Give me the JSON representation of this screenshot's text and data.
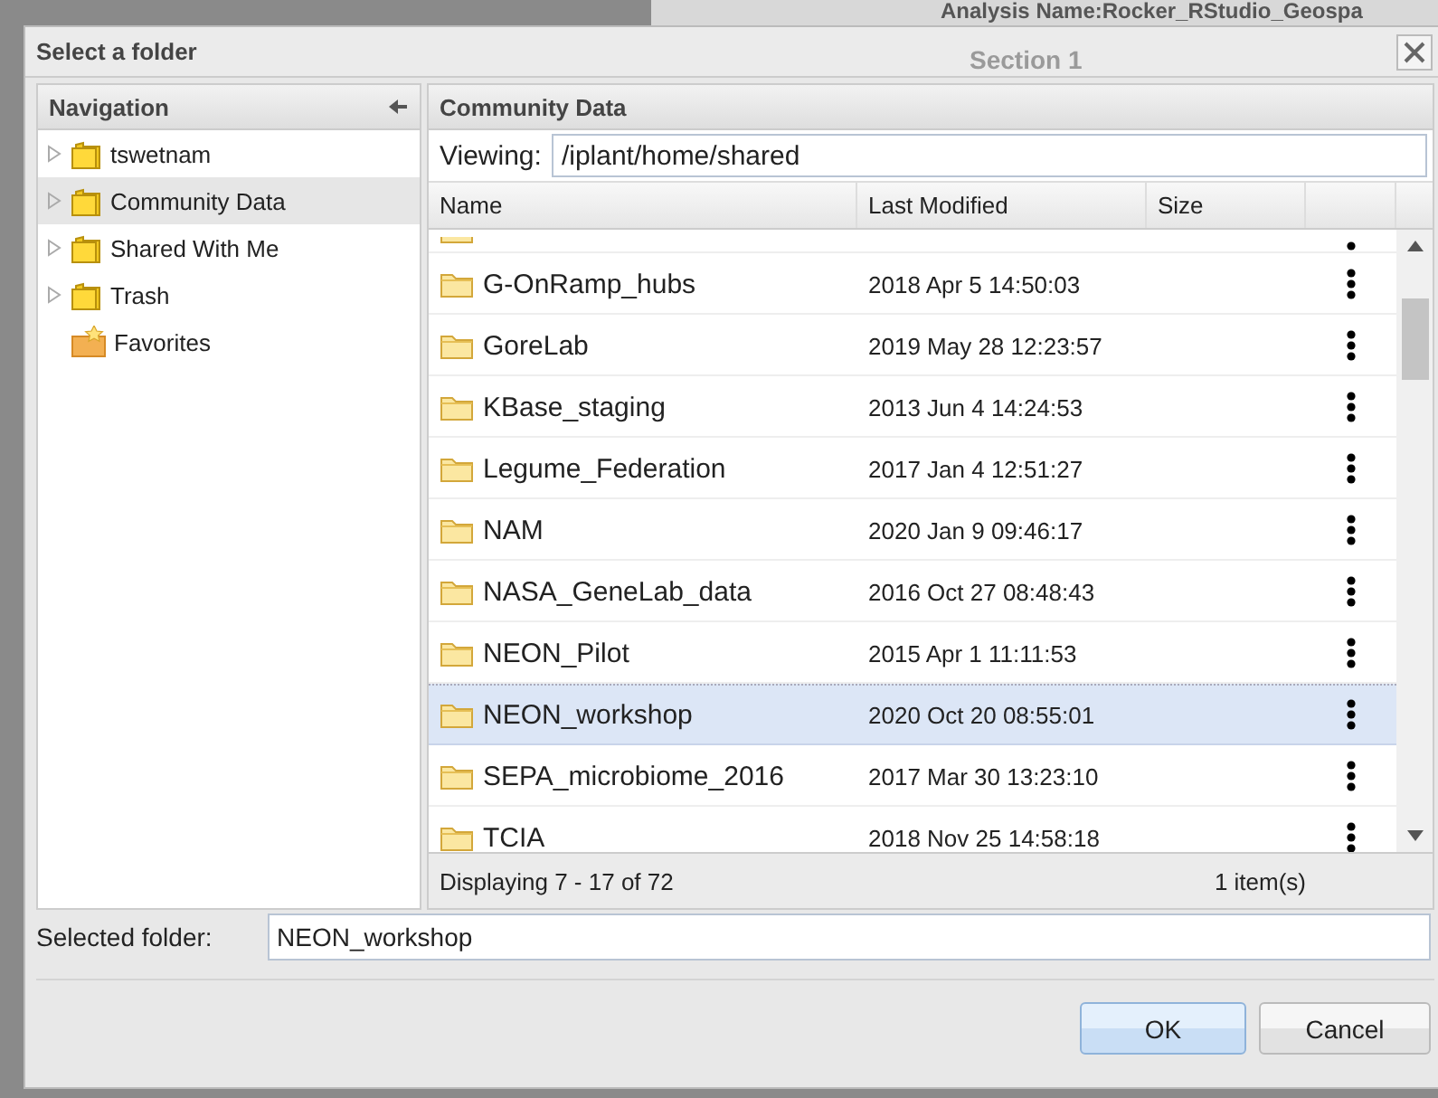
{
  "background": {
    "analysis_name": "Analysis Name:Rocker_RStudio_Geospa",
    "section": "Section 1"
  },
  "window": {
    "title": "Select a folder"
  },
  "navigation": {
    "title": "Navigation",
    "items": [
      {
        "label": "tswetnam",
        "kind": "folder",
        "selected": false
      },
      {
        "label": "Community Data",
        "kind": "folder",
        "selected": true
      },
      {
        "label": "Shared With Me",
        "kind": "folder",
        "selected": false
      },
      {
        "label": "Trash",
        "kind": "folder",
        "selected": false
      },
      {
        "label": "Favorites",
        "kind": "favorites",
        "selected": false
      }
    ]
  },
  "content": {
    "title": "Community Data",
    "viewing_label": "Viewing:",
    "path": "/iplant/home/shared",
    "columns": [
      "Name",
      "Last Modified",
      "Size"
    ],
    "rows": [
      {
        "name": "G-OnRamp_hubs",
        "modified": "2018 Apr 5 14:50:03",
        "selected": false
      },
      {
        "name": "GoreLab",
        "modified": "2019 May 28 12:23:57",
        "selected": false
      },
      {
        "name": "KBase_staging",
        "modified": "2013 Jun 4 14:24:53",
        "selected": false
      },
      {
        "name": "Legume_Federation",
        "modified": "2017 Jan 4 12:51:27",
        "selected": false
      },
      {
        "name": "NAM",
        "modified": "2020 Jan 9 09:46:17",
        "selected": false
      },
      {
        "name": "NASA_GeneLab_data",
        "modified": "2016 Oct 27 08:48:43",
        "selected": false
      },
      {
        "name": "NEON_Pilot",
        "modified": "2015 Apr 1 11:11:53",
        "selected": false
      },
      {
        "name": "NEON_workshop",
        "modified": "2020 Oct 20 08:55:01",
        "selected": true
      },
      {
        "name": "SEPA_microbiome_2016",
        "modified": "2017 Mar 30 13:23:10",
        "selected": false
      },
      {
        "name": "TCIA",
        "modified": "2018 Nov 25 14:58:18",
        "selected": false
      }
    ],
    "paging": "Displaying 7 - 17 of 72",
    "selection_count": "1 item(s)"
  },
  "selected_folder": {
    "label": "Selected folder:",
    "value": "NEON_workshop"
  },
  "buttons": [
    {
      "label": "OK",
      "kind": "primary"
    },
    {
      "label": "Cancel",
      "kind": "secondary"
    }
  ]
}
